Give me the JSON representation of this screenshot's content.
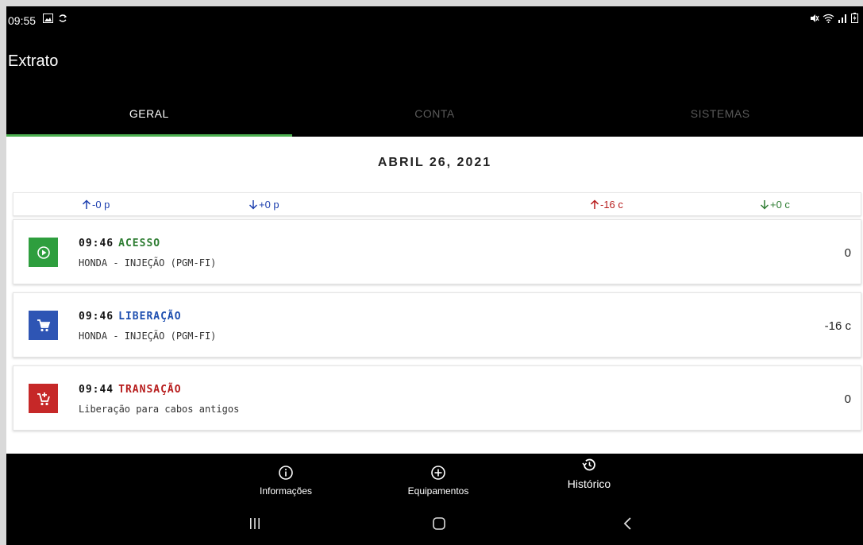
{
  "status_bar": {
    "time": "09:55",
    "left_icons": [
      "image-icon",
      "sync-icon"
    ],
    "right_icons": [
      "mute-icon",
      "wifi-icon",
      "signal-icon",
      "battery-charging-icon"
    ]
  },
  "app_bar": {
    "title": "Extrato"
  },
  "tabs": [
    {
      "label": "GERAL",
      "active": true
    },
    {
      "label": "CONTA",
      "active": false
    },
    {
      "label": "SISTEMAS",
      "active": false
    }
  ],
  "date_header": "ABRIL 26, 2021",
  "summary": [
    {
      "text": "-0 p",
      "arrow": "up",
      "color": "#1e40af"
    },
    {
      "text": "+0 p",
      "arrow": "down",
      "color": "#1e40af"
    },
    {
      "text": "-16 c",
      "arrow": "up",
      "color": "#b71c1c"
    },
    {
      "text": "+0 c",
      "arrow": "down",
      "color": "#2e7d32"
    }
  ],
  "entries": [
    {
      "time": "09:46",
      "type": "ACESSO",
      "type_color": "#2e7d32",
      "icon": "play-circle-icon",
      "icon_bg": "#2e9e3e",
      "subtitle": "HONDA - INJEÇÃO (PGM-FI)",
      "amount": "0"
    },
    {
      "time": "09:46",
      "type": "LIBERAÇÃO",
      "type_color": "#1e4fb0",
      "icon": "shopping-cart-icon",
      "icon_bg": "#2e55b4",
      "subtitle": "HONDA - INJEÇÃO (PGM-FI)",
      "amount": "-16 c"
    },
    {
      "time": "09:44",
      "type": "TRANSAÇÃO",
      "type_color": "#b71c1c",
      "icon": "add-shopping-cart-icon",
      "icon_bg": "#c62828",
      "subtitle": "Liberação para cabos antigos",
      "amount": "0"
    }
  ],
  "bottom_nav": [
    {
      "label": "Informações",
      "icon": "info-icon"
    },
    {
      "label": "Equipamentos",
      "icon": "add-circle-icon"
    },
    {
      "label": "Histórico",
      "icon": "history-icon"
    }
  ],
  "system_nav": [
    "recents-icon",
    "home-icon",
    "back-icon"
  ]
}
